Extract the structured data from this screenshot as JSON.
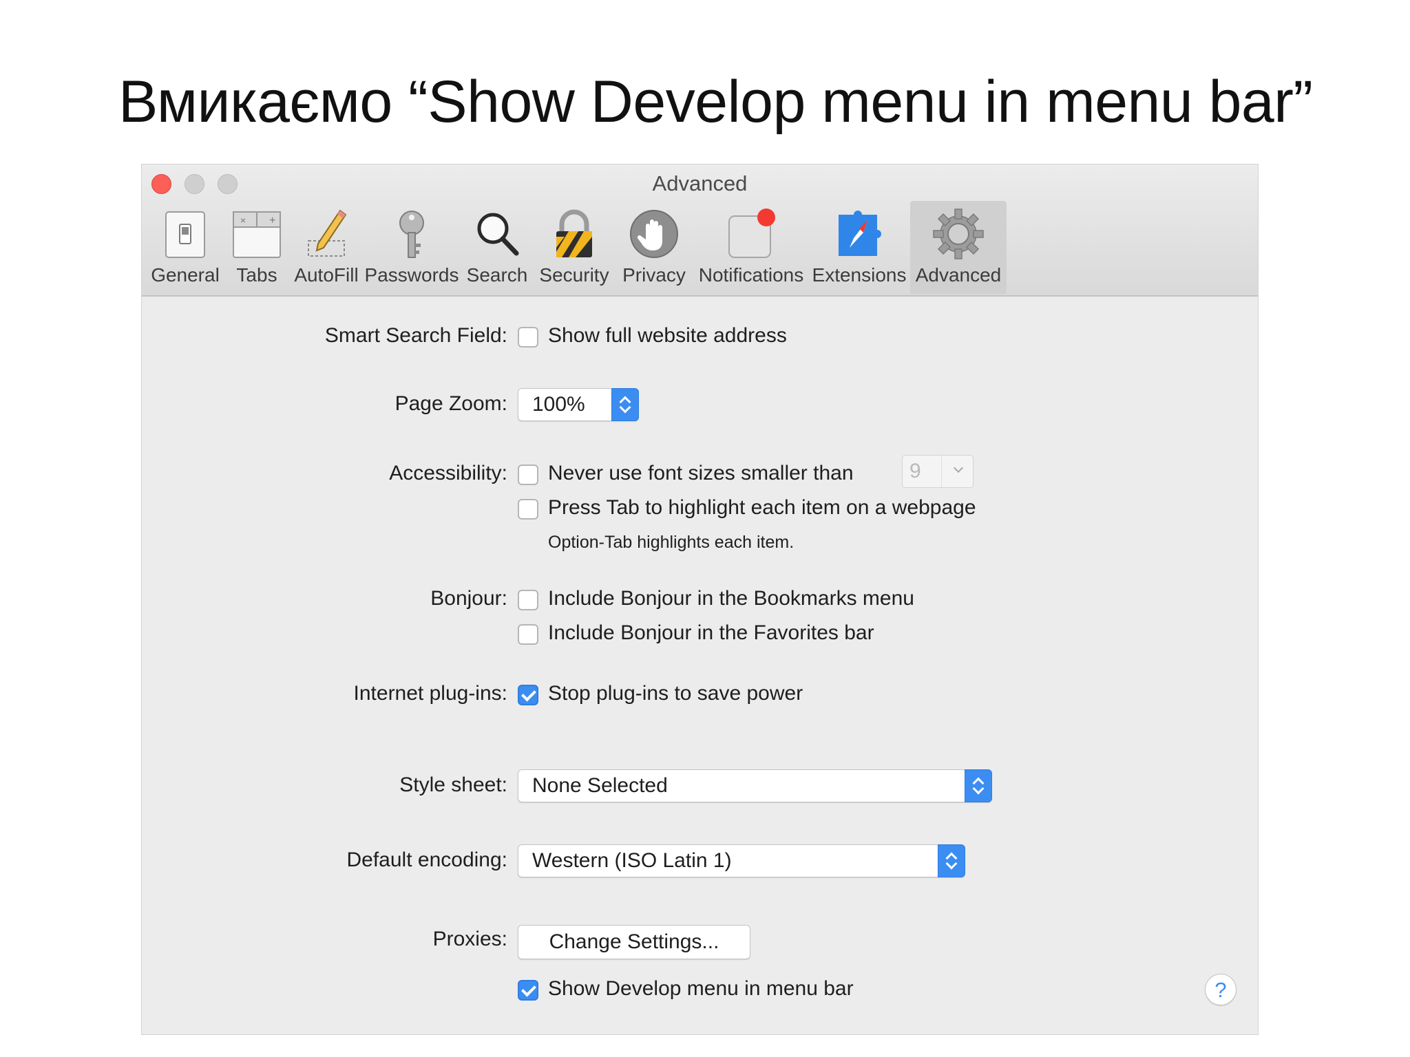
{
  "slide": {
    "title": "Вмикаємо “Show Develop menu in menu bar”"
  },
  "window": {
    "title": "Advanced",
    "toolbar": [
      {
        "label": "General",
        "icon": "general-switch-icon"
      },
      {
        "label": "Tabs",
        "icon": "tabs-icon"
      },
      {
        "label": "AutoFill",
        "icon": "pencil-icon"
      },
      {
        "label": "Passwords",
        "icon": "key-icon"
      },
      {
        "label": "Search",
        "icon": "magnifier-icon"
      },
      {
        "label": "Security",
        "icon": "padlock-icon"
      },
      {
        "label": "Privacy",
        "icon": "hand-icon"
      },
      {
        "label": "Notifications",
        "icon": "notification-badge-icon"
      },
      {
        "label": "Extensions",
        "icon": "puzzle-compass-icon"
      },
      {
        "label": "Advanced",
        "icon": "gear-icon",
        "selected": true
      }
    ]
  },
  "settings": {
    "smart_search": {
      "label": "Smart Search Field:",
      "option": "Show full website address",
      "checked": false
    },
    "page_zoom": {
      "label": "Page Zoom:",
      "value": "100%"
    },
    "accessibility": {
      "label": "Accessibility:",
      "font_option": "Never use font sizes smaller than",
      "font_checked": false,
      "font_size": "9",
      "tab_option": "Press Tab to highlight each item on a webpage",
      "tab_checked": false,
      "hint": "Option-Tab highlights each item."
    },
    "bonjour": {
      "label": "Bonjour:",
      "bookmarks_option": "Include Bonjour in the Bookmarks menu",
      "bookmarks_checked": false,
      "favorites_option": "Include Bonjour in the Favorites bar",
      "favorites_checked": false
    },
    "plugins": {
      "label": "Internet plug-ins:",
      "option": "Stop plug-ins to save power",
      "checked": true
    },
    "style_sheet": {
      "label": "Style sheet:",
      "value": "None Selected"
    },
    "encoding": {
      "label": "Default encoding:",
      "value": "Western (ISO Latin 1)"
    },
    "proxies": {
      "label": "Proxies:",
      "button": "Change Settings..."
    },
    "develop": {
      "option": "Show Develop menu in menu bar",
      "checked": true
    },
    "help": "?"
  },
  "colors": {
    "accent": "#3b8df1",
    "close": "#fc5f57",
    "background": "#ececec"
  }
}
